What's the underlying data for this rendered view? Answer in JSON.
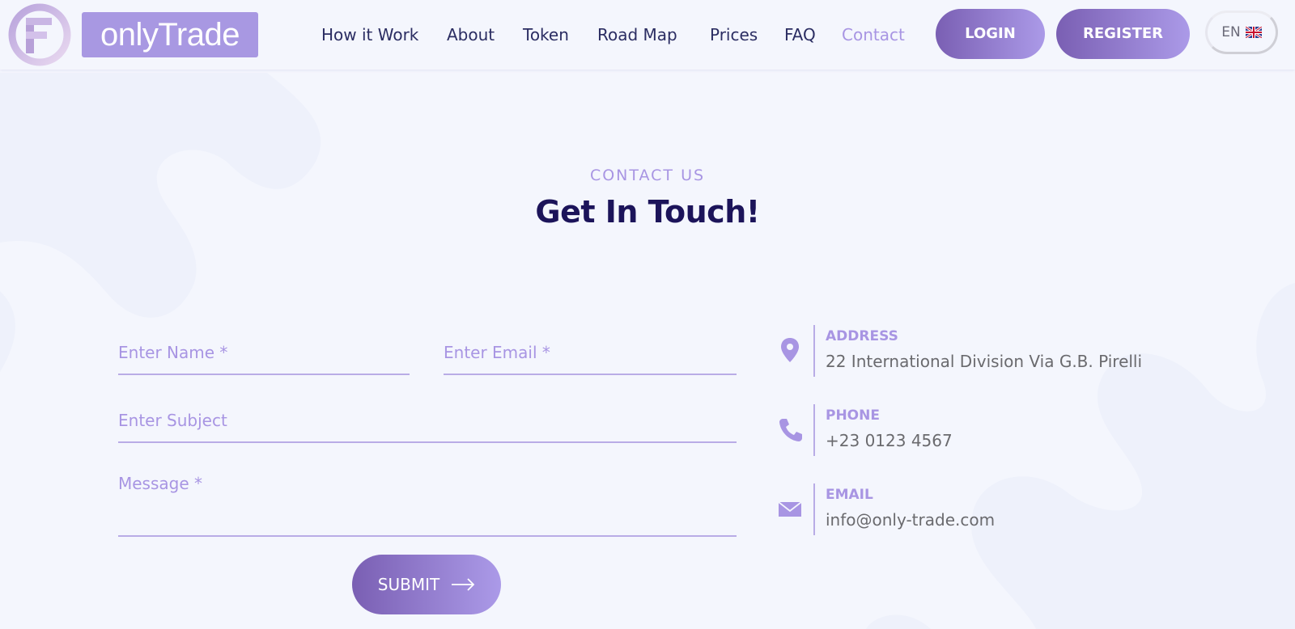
{
  "brand": {
    "name": "onlyTrade"
  },
  "nav": {
    "items": [
      {
        "label": "How it Work"
      },
      {
        "label": "About"
      },
      {
        "label": "Token"
      },
      {
        "label": "Road Map"
      },
      {
        "label": "Prices"
      },
      {
        "label": "FAQ"
      },
      {
        "label": "Contact",
        "active": true
      }
    ],
    "login_label": "LOGIN",
    "register_label": "REGISTER",
    "language": "EN",
    "language_flag_icon": "uk-flag-icon"
  },
  "section": {
    "eyebrow": "CONTACT US",
    "heading": "Get In Touch!"
  },
  "form": {
    "name_placeholder": "Enter Name *",
    "email_placeholder": "Enter Email *",
    "subject_placeholder": "Enter Subject",
    "message_placeholder": "Message *",
    "submit_label": "SUBMIT",
    "submit_icon": "arrow-right-icon"
  },
  "contact_info": {
    "address": {
      "icon": "map-pin-icon",
      "label": "ADDRESS",
      "value": "22 International Division Via G.B. Pirelli"
    },
    "phone": {
      "icon": "phone-icon",
      "label": "PHONE",
      "value": "+23 0123 4567"
    },
    "email": {
      "icon": "envelope-icon",
      "label": "EMAIL",
      "value": "info@only-trade.com"
    }
  },
  "colors": {
    "background": "#f4f6fd",
    "accent": "#a895e3",
    "accent_dark": "#7a5fb3",
    "heading": "#1c145a",
    "nav_text": "#2b2d62",
    "info_text": "#6a6a6e"
  }
}
